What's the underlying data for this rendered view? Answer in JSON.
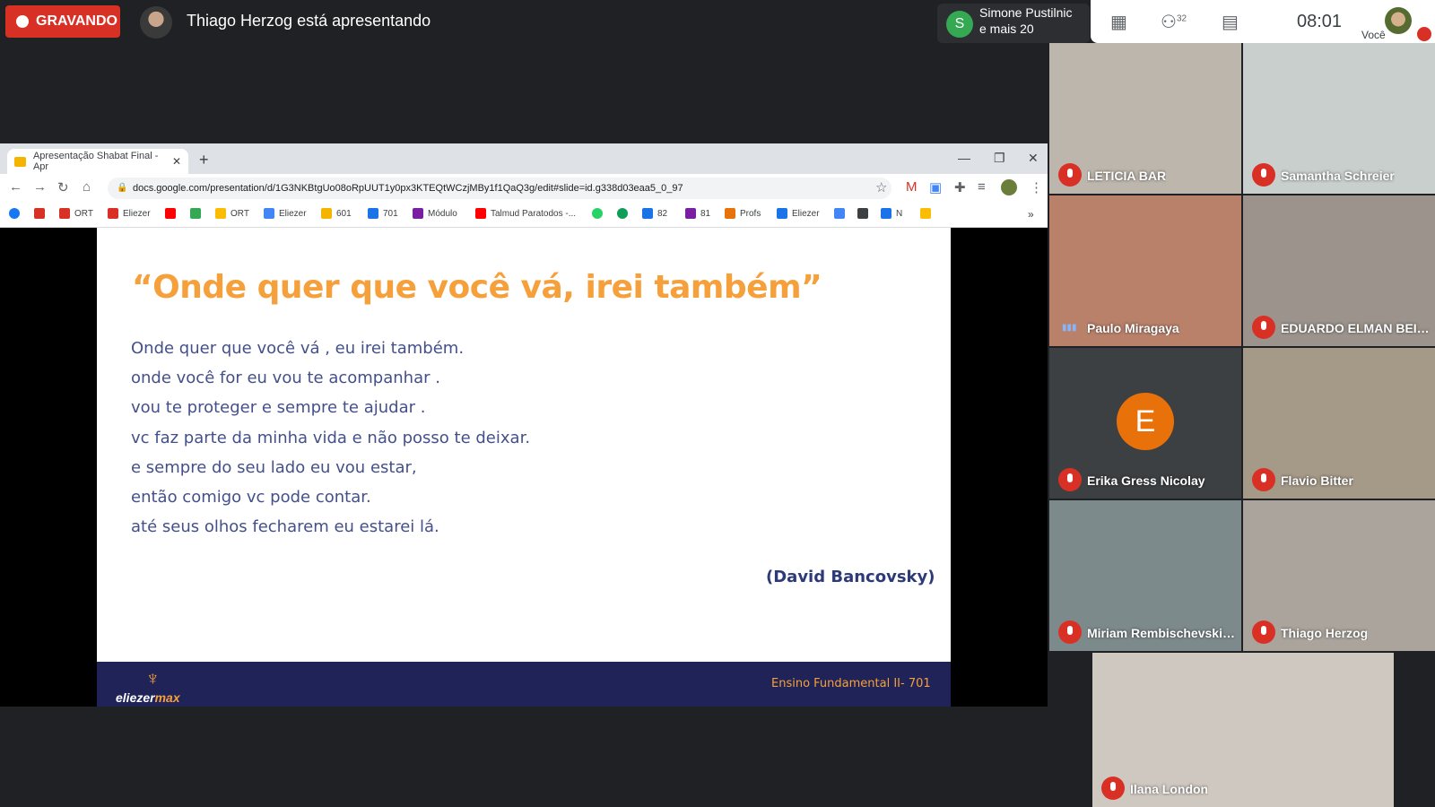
{
  "recording": {
    "label": "GRAVANDO"
  },
  "presenter": {
    "text": "Thiago Herzog está apresentando"
  },
  "presenting_pill": {
    "avatar_letter": "S",
    "line1": "Simone Pustilnic",
    "line2": "e mais 20"
  },
  "toolbar": {
    "people_count": "32",
    "time": "08:01",
    "self_label": "Você"
  },
  "browser": {
    "tab_title": "Apresentação Shabat Final - Apr",
    "url": "docs.google.com/presentation/d/1G3NKBtgUo08oRpUUT1y0px3KTEQtWCzjMBy1f1QaQ3g/edit#slide=id.g338d03eaa5_0_97",
    "bookmarks": [
      "ORT",
      "Eliezer",
      "ORT",
      "Eliezer",
      "601",
      "701",
      "Módulo",
      "Talmud Paratodos -...",
      "82",
      "81",
      "Profs",
      "Eliezer",
      "N"
    ]
  },
  "slide": {
    "title": "“Onde quer que você vá, irei também”",
    "lines": [
      "Onde quer que você vá , eu irei também.",
      "onde você  for eu vou te acompanhar .",
      "vou te proteger e sempre te ajudar .",
      "vc faz parte da minha vida e não posso te deixar.",
      "e sempre do seu lado  eu vou estar,",
      "então comigo vc pode contar.",
      "até seus olhos fecharem eu estarei lá."
    ],
    "author": "(David Bancovsky)",
    "logo_a": "eliezer",
    "logo_b": "max",
    "footer": "Ensino Fundamental II- 701"
  },
  "participants": [
    {
      "name": "LETICIA BAR",
      "muted": true,
      "bg": "#bdb6ad"
    },
    {
      "name": "Samantha Schreier",
      "muted": true,
      "bg": "#c8cfcc"
    },
    {
      "name": "Paulo Miragaya",
      "muted": false,
      "bg": "#b9816a"
    },
    {
      "name": "EDUARDO ELMAN BEIL...",
      "muted": true,
      "bg": "#9c948c"
    },
    {
      "name": "Erika Gress Nicolay",
      "muted": true,
      "bg": "#3c4043",
      "avatar": "E"
    },
    {
      "name": "Flavio Bitter",
      "muted": true,
      "bg": "#a59988"
    },
    {
      "name": "Miriam Rembischevski ...",
      "muted": true,
      "bg": "#7d8a8c"
    },
    {
      "name": "Thiago Herzog",
      "muted": true,
      "bg": "#aaa49c"
    },
    {
      "name": "Ilana London",
      "muted": true,
      "bg": "#cfc8c0"
    }
  ]
}
